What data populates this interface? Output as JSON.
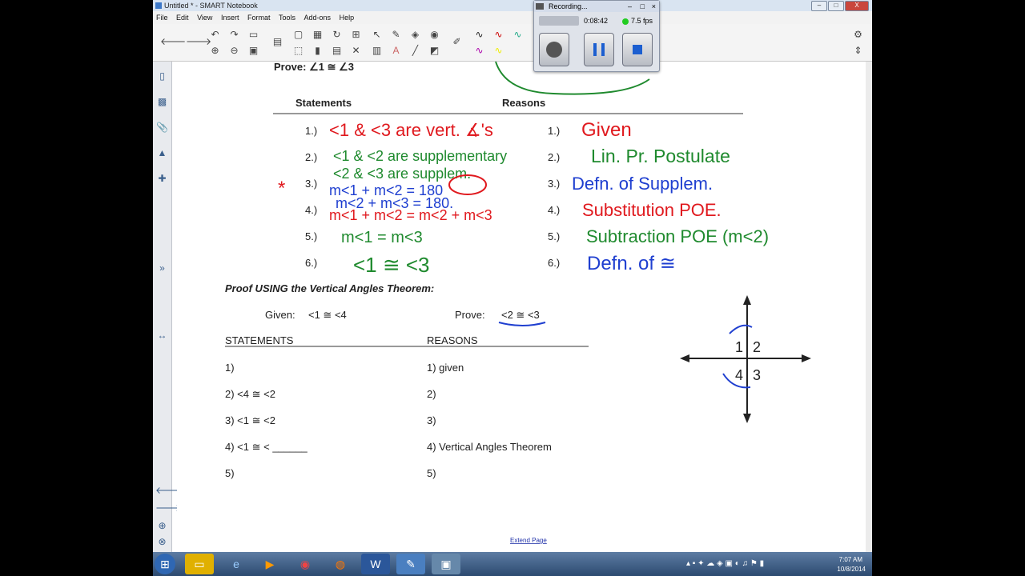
{
  "window": {
    "title": "Untitled * - SMART Notebook",
    "min": "–",
    "max": "□",
    "close": "X"
  },
  "menu": [
    "File",
    "Edit",
    "View",
    "Insert",
    "Format",
    "Tools",
    "Add-ons",
    "Help"
  ],
  "recorder": {
    "title": "Recording...",
    "elapsed": "0:08:42",
    "fps": "7.5 fps"
  },
  "page": {
    "prove_top": "Prove:   ∠1 ≅ ∠3",
    "col_statements": "Statements",
    "col_reasons": "Reasons",
    "rows": [
      "1.)",
      "2.)",
      "3.)",
      "4.)",
      "5.)",
      "6.)"
    ],
    "reason_rows": [
      "1.)",
      "2.)",
      "3.)",
      "4.)",
      "5.)",
      "6.)"
    ],
    "hand_statements": [
      "<1 & <3 are vert. ∡'s",
      "<1 & <2 are supplementary",
      "<2 & <3 are supplem.",
      "m<1 + m<2 = 180",
      "m<2 + m<3 = 180.",
      "m<1 + m<2 = m<2 + m<3",
      "m<1 = m<3",
      "<1 ≅ <3"
    ],
    "hand_reasons": [
      "Given",
      "Lin. Pr. Postulate",
      "Defn. of Supplem.",
      "Substitution POE.",
      "Subtraction POE (m<2)",
      "Defn. of ≅"
    ],
    "star": "*",
    "proof2_title": "Proof USING the Vertical Angles Theorem:",
    "given_label": "Given:",
    "given_value": "<1 ≅ <4",
    "prove_label": "Prove:",
    "prove_value": "<2 ≅ <3",
    "col2_statements": "STATEMENTS",
    "col2_reasons": "REASONS",
    "stmt2": [
      "1)",
      "2)   <4 ≅ <2",
      "3)   <1 ≅ <2",
      "4)   <1 ≅ < ______",
      "5)"
    ],
    "rsn2": [
      "1)  given",
      "2)",
      "3)",
      "4)   Vertical Angles Theorem",
      "5)"
    ],
    "diagram_labels": [
      "1",
      "2",
      "4",
      "3"
    ],
    "extend": "Extend Page"
  },
  "tray": {
    "time": "7:07 AM",
    "date": "10/8/2014"
  },
  "colors": {
    "red": "#e0191e",
    "green": "#1f8a2e",
    "blue": "#1f3fd0"
  }
}
